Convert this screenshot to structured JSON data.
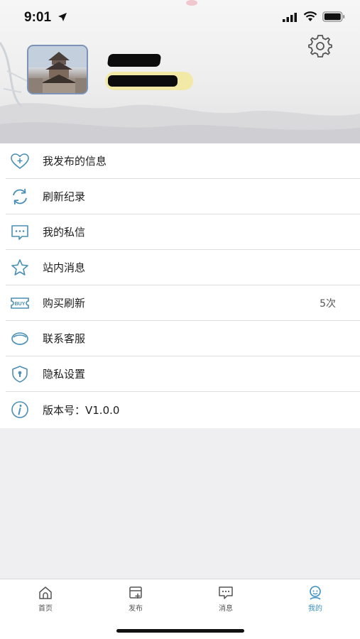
{
  "status_bar": {
    "time": "9:01"
  },
  "profile": {},
  "menu": {
    "items": [
      {
        "label": "我发布的信息",
        "icon": "heart-plus-icon"
      },
      {
        "label": "刷新纪录",
        "icon": "refresh-icon"
      },
      {
        "label": "我的私信",
        "icon": "chat-bubble-icon"
      },
      {
        "label": "站内消息",
        "icon": "star-icon"
      },
      {
        "label": "购买刷新",
        "icon": "buy-ticket-icon",
        "value": "5次"
      },
      {
        "label": "联系客服",
        "icon": "support-icon"
      },
      {
        "label": "隐私设置",
        "icon": "shield-lock-icon"
      },
      {
        "label": "版本号：V1.0.0",
        "icon": "info-icon"
      }
    ]
  },
  "tabbar": {
    "tabs": [
      {
        "label": "首页",
        "icon": "home-icon"
      },
      {
        "label": "发布",
        "icon": "publish-icon"
      },
      {
        "label": "消息",
        "icon": "message-icon"
      },
      {
        "label": "我的",
        "icon": "profile-icon",
        "active": true
      }
    ]
  },
  "colors": {
    "accent": "#3b8ec2",
    "icon_stroke": "#4a8fb6",
    "phone_highlight": "#f3e9a6"
  }
}
